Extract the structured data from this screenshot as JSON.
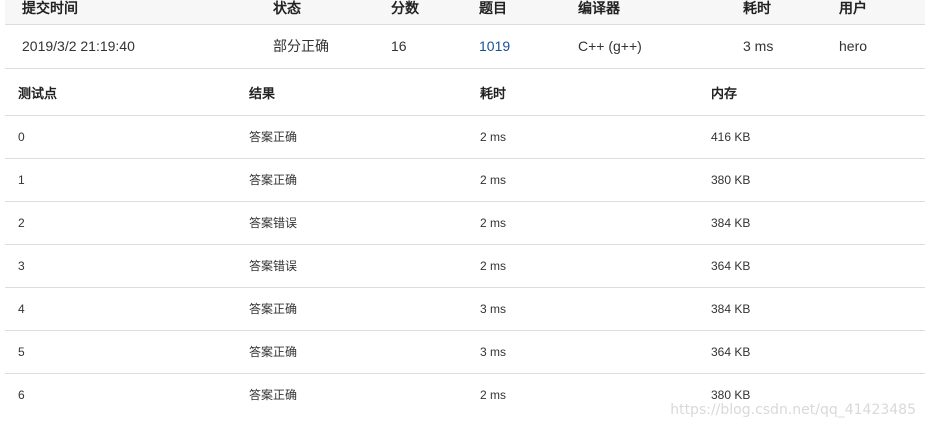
{
  "submission": {
    "headers": {
      "time": "提交时间",
      "status": "状态",
      "score": "分数",
      "problem": "题目",
      "compiler": "编译器",
      "duration": "耗时",
      "user": "用户"
    },
    "row": {
      "time": "2019/3/2 21:19:40",
      "status": "部分正确",
      "score": "16",
      "problem": "1019",
      "compiler": "C++ (g++)",
      "duration": "3 ms",
      "user": "hero"
    }
  },
  "testpoints": {
    "headers": {
      "case": "测试点",
      "result": "结果",
      "duration": "耗时",
      "memory": "内存"
    },
    "rows": [
      {
        "case": "0",
        "result": "答案正确",
        "duration": "2 ms",
        "memory": "416 KB"
      },
      {
        "case": "1",
        "result": "答案正确",
        "duration": "2 ms",
        "memory": "380 KB"
      },
      {
        "case": "2",
        "result": "答案错误",
        "duration": "2 ms",
        "memory": "384 KB"
      },
      {
        "case": "3",
        "result": "答案错误",
        "duration": "2 ms",
        "memory": "364 KB"
      },
      {
        "case": "4",
        "result": "答案正确",
        "duration": "3 ms",
        "memory": "384 KB"
      },
      {
        "case": "5",
        "result": "答案正确",
        "duration": "3 ms",
        "memory": "364 KB"
      },
      {
        "case": "6",
        "result": "答案正确",
        "duration": "2 ms",
        "memory": "380 KB"
      }
    ]
  },
  "colors": {
    "accepted": "#e74c3c",
    "wrong_answer": "#43a047",
    "partial": "#43a047",
    "link": "#1a4f9c"
  },
  "watermark": "https://blog.csdn.net/qq_41423485"
}
